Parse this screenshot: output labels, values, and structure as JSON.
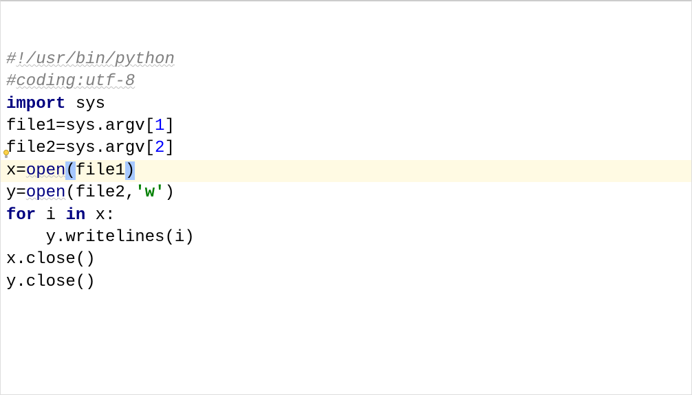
{
  "editor": {
    "font": "monospace",
    "highlighted_line_index": 5,
    "lightbulb_line_index": 4,
    "lines": [
      {
        "tokens": [
          {
            "t": "#",
            "c": "comment"
          },
          {
            "t": "!/usr/bin/python",
            "c": "comment",
            "wavy": true
          }
        ]
      },
      {
        "tokens": [
          {
            "t": "#",
            "c": "comment"
          },
          {
            "t": "coding:utf-8",
            "c": "comment",
            "wavy": true
          }
        ]
      },
      {
        "tokens": [
          {
            "t": "import",
            "c": "keyword"
          },
          {
            "t": " sys",
            "c": "plain"
          }
        ]
      },
      {
        "tokens": [
          {
            "t": "file1=sys.argv[",
            "c": "plain"
          },
          {
            "t": "1",
            "c": "number"
          },
          {
            "t": "]",
            "c": "plain"
          }
        ]
      },
      {
        "tokens": [
          {
            "t": "file2=sys.argv[",
            "c": "plain"
          },
          {
            "t": "2",
            "c": "number"
          },
          {
            "t": "]",
            "c": "plain"
          }
        ]
      },
      {
        "tokens": [
          {
            "t": "x=",
            "c": "plain"
          },
          {
            "t": "open",
            "c": "builtin",
            "wavy": true
          },
          {
            "t": "(",
            "c": "plain",
            "sel": true
          },
          {
            "t": "file1",
            "c": "plain"
          },
          {
            "t": ")",
            "c": "plain",
            "sel": true
          }
        ]
      },
      {
        "tokens": [
          {
            "t": "y=",
            "c": "plain"
          },
          {
            "t": "open",
            "c": "builtin",
            "wavy": true
          },
          {
            "t": "(file2,",
            "c": "plain"
          },
          {
            "t": "'w'",
            "c": "string"
          },
          {
            "t": ")",
            "c": "plain"
          }
        ]
      },
      {
        "tokens": [
          {
            "t": "for",
            "c": "keyword"
          },
          {
            "t": " i ",
            "c": "plain"
          },
          {
            "t": "in",
            "c": "keyword"
          },
          {
            "t": " x:",
            "c": "plain"
          }
        ]
      },
      {
        "tokens": [
          {
            "t": "    y.writelines(i)",
            "c": "plain"
          }
        ]
      },
      {
        "tokens": [
          {
            "t": "x.close()",
            "c": "plain"
          }
        ]
      },
      {
        "tokens": [
          {
            "t": "y.close()",
            "c": "plain"
          }
        ]
      }
    ]
  }
}
